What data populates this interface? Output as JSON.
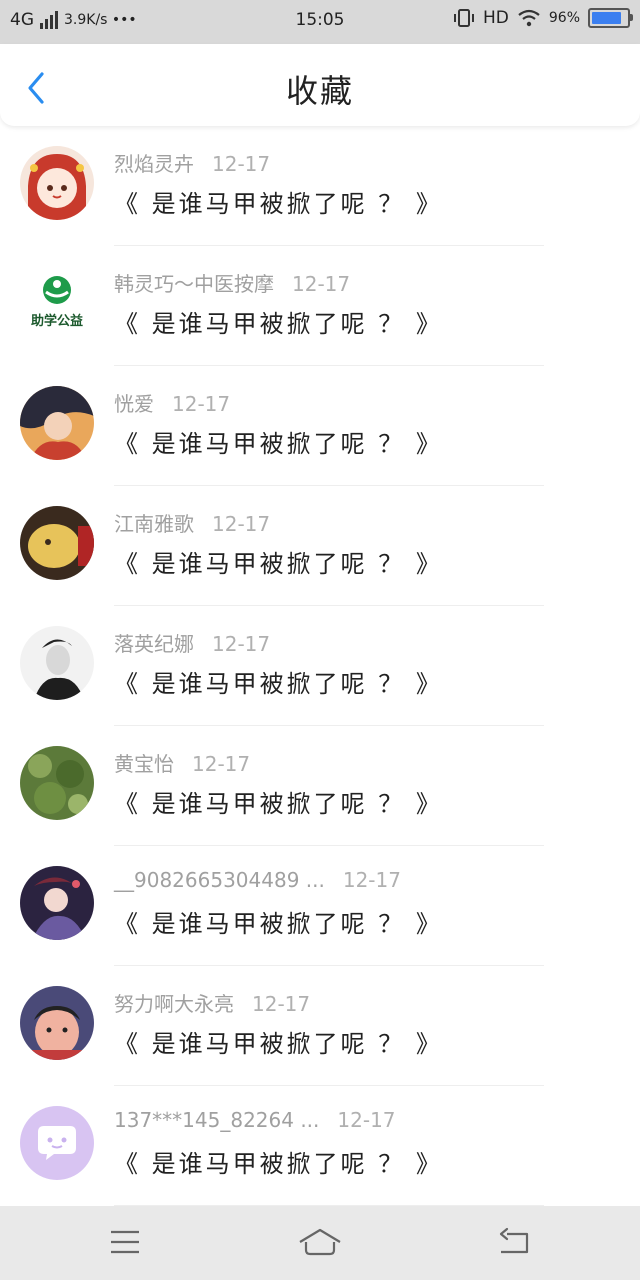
{
  "status_bar": {
    "network": "4G",
    "speed": "3.9K/s •••",
    "time": "15:05",
    "hd": "HD",
    "battery_pct": "96%",
    "battery_level": 0.96
  },
  "header": {
    "title": "收藏",
    "back_icon": "chevron-left-icon"
  },
  "items": [
    {
      "name": "烈焰灵卉",
      "date": "12-17",
      "message": "《 是谁马甲被掀了呢 ？ 》",
      "avatar": "avatar-cartoon-girl"
    },
    {
      "name": "韩灵巧～中医按摩",
      "date": "12-17",
      "message": "《 是谁马甲被掀了呢 ？ 》",
      "avatar": "avatar-logo",
      "avatar_text": "助学公益"
    },
    {
      "name": "恍爱",
      "date": "12-17",
      "message": "《 是谁马甲被掀了呢 ？ 》",
      "avatar": "avatar-illustration"
    },
    {
      "name": "江南雅歌",
      "date": "12-17",
      "message": "《 是谁马甲被掀了呢 ？ 》",
      "avatar": "avatar-photo-yellow"
    },
    {
      "name": "落英纪娜",
      "date": "12-17",
      "message": "《 是谁马甲被掀了呢 ？ 》",
      "avatar": "avatar-bw-portrait"
    },
    {
      "name": "黄宝怡",
      "date": "12-17",
      "message": "《 是谁马甲被掀了呢 ？ 》",
      "avatar": "avatar-leaves"
    },
    {
      "name": "__9082665304489 ...",
      "date": "12-17",
      "message": "《 是谁马甲被掀了呢 ？ 》",
      "avatar": "avatar-anime"
    },
    {
      "name": "努力啊大永亮",
      "date": "12-17",
      "message": "《 是谁马甲被掀了呢 ？ 》",
      "avatar": "avatar-child"
    },
    {
      "name": "137***145_82264 ...",
      "date": "12-17",
      "message": "《 是谁马甲被掀了呢 ？ 》",
      "avatar": "avatar-default-chat"
    }
  ],
  "bottom_nav": {
    "menu_icon": "menu-icon",
    "home_icon": "home-icon",
    "back_icon": "back-arrow-icon"
  },
  "colors": {
    "accent": "#2a8df0",
    "status_bar_bg": "#d9d9d9",
    "bottom_bar_bg": "#e9e9e9"
  }
}
